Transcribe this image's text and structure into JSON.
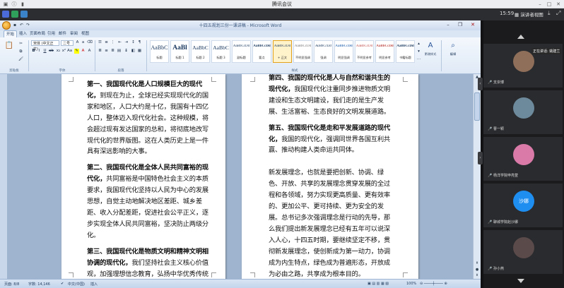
{
  "meeting": {
    "app_title": "腾讯会议",
    "clock": "15:59",
    "view_label": "演讲者视图"
  },
  "word": {
    "doc_title": "十四五规划三份一课讲稿 - Microsoft Word",
    "tabs": [
      "开始",
      "插入",
      "页面布局",
      "引用",
      "邮件",
      "审阅",
      "视图"
    ],
    "font_name": "宋体 (中文正文)",
    "font_size": "二号",
    "groups": [
      "剪贴板",
      "字体",
      "段落",
      "样式"
    ],
    "styles": [
      {
        "sample": "AaBbC",
        "name": "标题"
      },
      {
        "sample": "AaBl",
        "name": "标题 1"
      },
      {
        "sample": "AaBbC",
        "name": "标题 2"
      },
      {
        "sample": "AaBbC",
        "name": "标题 3"
      },
      {
        "sample": "AaBbCcDd",
        "name": "副标题"
      },
      {
        "sample": "AaBbCcDd",
        "name": "要点"
      },
      {
        "sample": "AaBbCcDd",
        "name": "+ 正文"
      },
      {
        "sample": "AaBbCcDd",
        "name": "不明显强调"
      },
      {
        "sample": "AaBbCcDd",
        "name": "强调"
      },
      {
        "sample": "AaBbCcDd",
        "name": "明显强调"
      },
      {
        "sample": "AaBbCcDd",
        "name": "不明显参考"
      },
      {
        "sample": "AaBbCcDd",
        "name": "明显参考"
      },
      {
        "sample": "AaBbCcDd",
        "name": "书籍标题"
      }
    ],
    "change_styles": "更改样式",
    "edit": "编辑",
    "status": {
      "page": "页面: 8/8",
      "words": "字数: 14,146",
      "lang": "中文(中国)",
      "mode": "插入",
      "zoom": "100%"
    }
  },
  "page_left": {
    "p1_bold": "第一、我国现代化是人口规模巨大的现代化，",
    "p1_rest": "到现在为止，全球已经实现现代化的国家和地区，人口大约是十亿，我国有十四亿人口，整体迈入现代化社会。这种规模，将会超过现有发达国家的总和，将彻底地改写现代化的世界版图。这在人类历史上是一件具有深远影响的大事。",
    "p2_bold": "第二、我国现代化是全体人民共同富裕的现代化，",
    "p2_rest": "共同富裕是中国特色社会主义的本质要求，我国现代化坚持以人民为中心的发展思想，自觉主动地解决地区差距、城乡差距、收入分配差距，促进社会公平正义，逐步实现全体人民共同富裕，坚决防止两级分化。",
    "p3_bold": "第三、我国现代化是物质文明和精神文明相协调的现代化，",
    "p3_rest": "我们坚持社会主义核心价值观，加强理想信念教育，弘扬中华优秀传统文化，增强人民精神力量，促进物的全面丰富和人的全面发展。"
  },
  "page_right": {
    "p4_bold": "第四、我国的现代化是人与自然和谐共生的现代化，",
    "p4_rest": "我国现代化注重同步推进物质文明建设和生态文明建设，我们走的是生产发展、生活富裕、生态良好的文明发展道路。",
    "p5_bold": "第五、我国现代化是走和平发展道路的现代化，",
    "p5_rest": "我国的现代化，强调同世界各国互利共赢、推动构建人类命运共同体。",
    "p6": "新发展理念，也就是要把创新、协调、绿色、开放、共享的发展理念贯穿发展的全过程和各领域，努力实现更高质量、更有效率的、更加公平、更可持续、更为安全的发展。总书记多次强调理念是行动的先导，那么我们提出新发展理念已经有五年可以说深入人心，十四五时期，要继续坚定不移，贯彻新发展理念，使创新成为第一动力，协调成为内生特点，绿色成为普遍形态，开放成为必由之路，共享成为根本目的。"
  },
  "participants": [
    {
      "name": "支崇博",
      "avatar_color": "#8f6f5a"
    },
    {
      "name": "曹一颖",
      "avatar_color": "#6d8a9c"
    },
    {
      "name": "杨洋学院申亮萱",
      "avatar_color": "#d97aa8"
    },
    {
      "name": "聊城学院赵沙娜",
      "avatar_text": "沙娜",
      "avatar_color": "#1f8ef1"
    },
    {
      "name": "孙小燕",
      "avatar_color": "#5a4a4a"
    }
  ],
  "speaking": "正在讲话: 姚建兰"
}
